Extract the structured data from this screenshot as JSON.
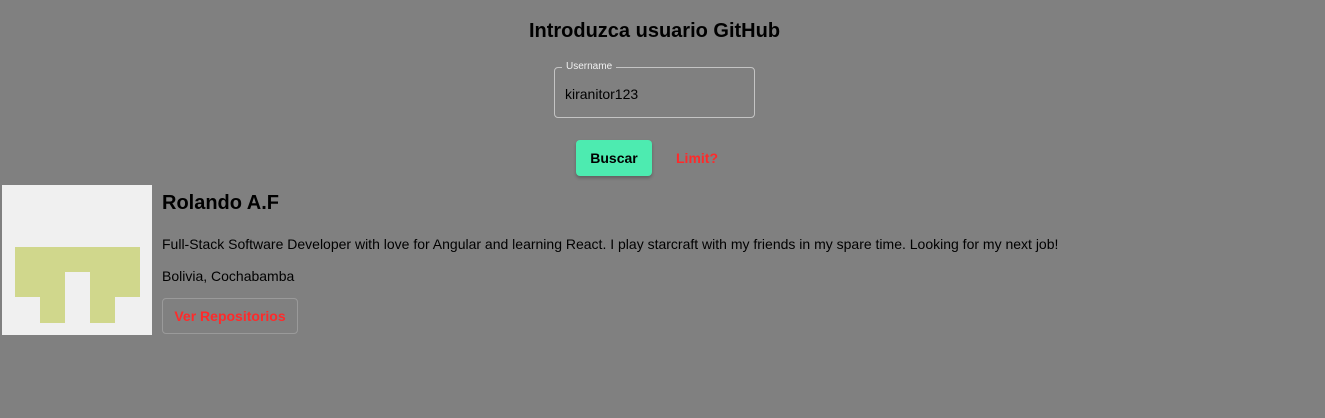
{
  "header": {
    "title": "Introduzca usuario GitHub"
  },
  "search": {
    "label": "Username",
    "value": "kiranitor123",
    "submit_label": "Buscar",
    "limit_label": "Limit?"
  },
  "user": {
    "name": "Rolando A.F",
    "bio": "Full-Stack Software Developer with love for Angular and learning React. I play starcraft with my friends in my spare time. Looking for my next job!",
    "location": "Bolivia, Cochabamba",
    "repos_label": "Ver Repositorios",
    "avatar_icon": "identicon-avatar-icon"
  },
  "colors": {
    "background": "#808080",
    "primary_button": "#4debb0",
    "accent_text": "#ff2a2a",
    "identicon": "#d0d78c",
    "avatar_bg": "#f0f0f0"
  }
}
